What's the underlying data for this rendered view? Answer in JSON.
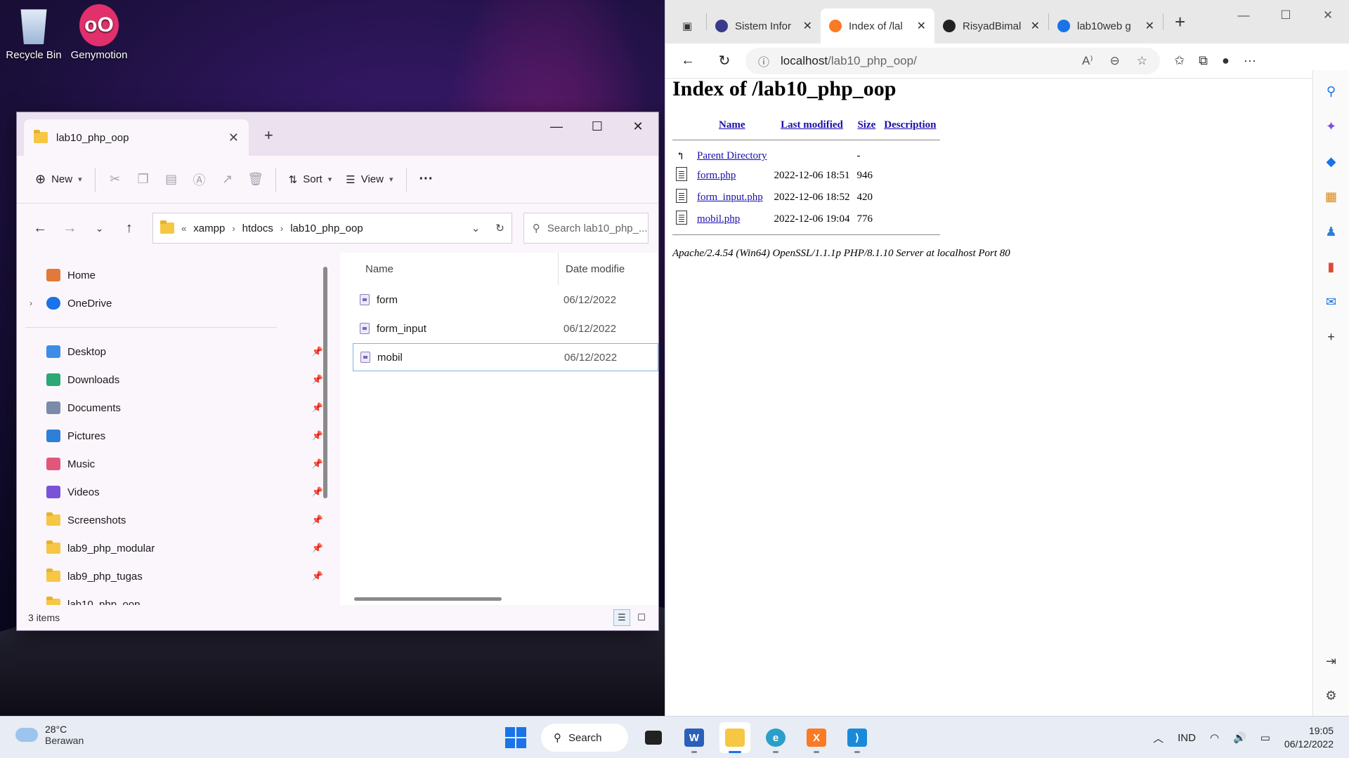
{
  "desktop": {
    "icons": [
      {
        "label": "Recycle Bin"
      },
      {
        "label": "Genymotion"
      }
    ]
  },
  "explorer": {
    "tab_title": "lab10_php_oop",
    "toolbar": {
      "new_label": "New",
      "sort_label": "Sort",
      "view_label": "View",
      "more_label": "···"
    },
    "breadcrumb": [
      "xampp",
      "htdocs",
      "lab10_php_oop"
    ],
    "search_placeholder": "Search lab10_php_...",
    "nav": {
      "home": "Home",
      "onedrive": "OneDrive",
      "quick_access": [
        {
          "label": "Desktop",
          "icon_color": "#3a8ee6"
        },
        {
          "label": "Downloads",
          "icon_color": "#2aa876"
        },
        {
          "label": "Documents",
          "icon_color": "#7a8ca8"
        },
        {
          "label": "Pictures",
          "icon_color": "#2d7fd8"
        },
        {
          "label": "Music",
          "icon_color": "#e0577a"
        },
        {
          "label": "Videos",
          "icon_color": "#7a52d8"
        },
        {
          "label": "Screenshots",
          "icon_color": "#f6c744"
        },
        {
          "label": "lab9_php_modular",
          "icon_color": "#f6c744"
        },
        {
          "label": "lab9_php_tugas",
          "icon_color": "#f6c744"
        },
        {
          "label": "lab10_php_oop",
          "icon_color": "#f6c744"
        }
      ]
    },
    "columns": {
      "name": "Name",
      "date": "Date modifie"
    },
    "files": [
      {
        "name": "form",
        "date": "06/12/2022"
      },
      {
        "name": "form_input",
        "date": "06/12/2022"
      },
      {
        "name": "mobil",
        "date": "06/12/2022"
      }
    ],
    "status": "3 items"
  },
  "browser": {
    "tabs": [
      {
        "title": "Sistem Infor",
        "favicon_color": "#3a3a8a"
      },
      {
        "title": "Index of /lal",
        "favicon_color": "#fb7a24"
      },
      {
        "title": "RisyadBimal",
        "favicon_color": "#222222"
      },
      {
        "title": "lab10web g",
        "favicon_color": "#1a73e8"
      }
    ],
    "url_host": "localhost",
    "url_path": "/lab10_php_oop/",
    "page": {
      "heading": "Index of /lab10_php_oop",
      "headers": {
        "name": "Name",
        "modified": "Last modified",
        "size": "Size",
        "description": "Description"
      },
      "parent": {
        "name": "Parent Directory",
        "size": "-"
      },
      "rows": [
        {
          "name": "form.php",
          "modified": "2022-12-06 18:51",
          "size": "946"
        },
        {
          "name": "form_input.php",
          "modified": "2022-12-06 18:52",
          "size": "420"
        },
        {
          "name": "mobil.php",
          "modified": "2022-12-06 19:04",
          "size": "776"
        }
      ],
      "server": "Apache/2.4.54 (Win64) OpenSSL/1.1.1p PHP/8.1.10 Server at localhost Port 80"
    }
  },
  "taskbar": {
    "weather_temp": "28°C",
    "weather_desc": "Berawan",
    "search_label": "Search",
    "language": "IND",
    "time": "19:05",
    "date": "06/12/2022"
  }
}
